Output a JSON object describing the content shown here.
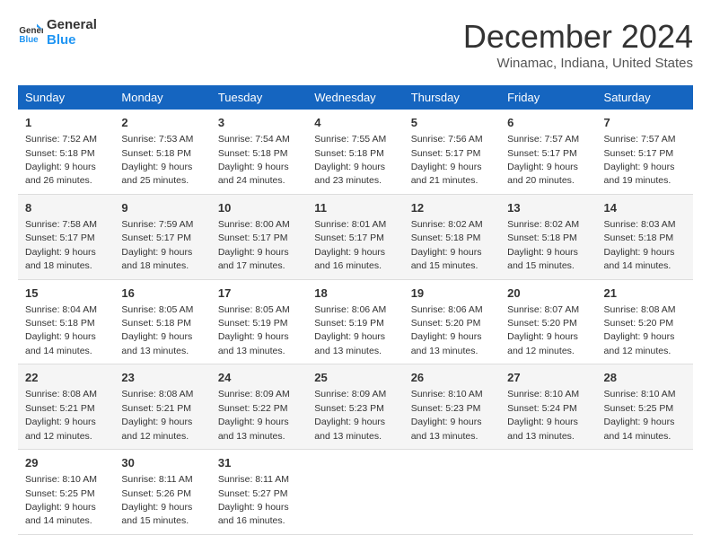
{
  "logo": {
    "line1": "General",
    "line2": "Blue"
  },
  "title": "December 2024",
  "location": "Winamac, Indiana, United States",
  "days_of_week": [
    "Sunday",
    "Monday",
    "Tuesday",
    "Wednesday",
    "Thursday",
    "Friday",
    "Saturday"
  ],
  "weeks": [
    [
      {
        "num": "1",
        "sunrise": "7:52 AM",
        "sunset": "5:18 PM",
        "daylight": "9 hours and 26 minutes."
      },
      {
        "num": "2",
        "sunrise": "7:53 AM",
        "sunset": "5:18 PM",
        "daylight": "9 hours and 25 minutes."
      },
      {
        "num": "3",
        "sunrise": "7:54 AM",
        "sunset": "5:18 PM",
        "daylight": "9 hours and 24 minutes."
      },
      {
        "num": "4",
        "sunrise": "7:55 AM",
        "sunset": "5:18 PM",
        "daylight": "9 hours and 23 minutes."
      },
      {
        "num": "5",
        "sunrise": "7:56 AM",
        "sunset": "5:17 PM",
        "daylight": "9 hours and 21 minutes."
      },
      {
        "num": "6",
        "sunrise": "7:57 AM",
        "sunset": "5:17 PM",
        "daylight": "9 hours and 20 minutes."
      },
      {
        "num": "7",
        "sunrise": "7:57 AM",
        "sunset": "5:17 PM",
        "daylight": "9 hours and 19 minutes."
      }
    ],
    [
      {
        "num": "8",
        "sunrise": "7:58 AM",
        "sunset": "5:17 PM",
        "daylight": "9 hours and 18 minutes."
      },
      {
        "num": "9",
        "sunrise": "7:59 AM",
        "sunset": "5:17 PM",
        "daylight": "9 hours and 18 minutes."
      },
      {
        "num": "10",
        "sunrise": "8:00 AM",
        "sunset": "5:17 PM",
        "daylight": "9 hours and 17 minutes."
      },
      {
        "num": "11",
        "sunrise": "8:01 AM",
        "sunset": "5:17 PM",
        "daylight": "9 hours and 16 minutes."
      },
      {
        "num": "12",
        "sunrise": "8:02 AM",
        "sunset": "5:18 PM",
        "daylight": "9 hours and 15 minutes."
      },
      {
        "num": "13",
        "sunrise": "8:02 AM",
        "sunset": "5:18 PM",
        "daylight": "9 hours and 15 minutes."
      },
      {
        "num": "14",
        "sunrise": "8:03 AM",
        "sunset": "5:18 PM",
        "daylight": "9 hours and 14 minutes."
      }
    ],
    [
      {
        "num": "15",
        "sunrise": "8:04 AM",
        "sunset": "5:18 PM",
        "daylight": "9 hours and 14 minutes."
      },
      {
        "num": "16",
        "sunrise": "8:05 AM",
        "sunset": "5:18 PM",
        "daylight": "9 hours and 13 minutes."
      },
      {
        "num": "17",
        "sunrise": "8:05 AM",
        "sunset": "5:19 PM",
        "daylight": "9 hours and 13 minutes."
      },
      {
        "num": "18",
        "sunrise": "8:06 AM",
        "sunset": "5:19 PM",
        "daylight": "9 hours and 13 minutes."
      },
      {
        "num": "19",
        "sunrise": "8:06 AM",
        "sunset": "5:20 PM",
        "daylight": "9 hours and 13 minutes."
      },
      {
        "num": "20",
        "sunrise": "8:07 AM",
        "sunset": "5:20 PM",
        "daylight": "9 hours and 12 minutes."
      },
      {
        "num": "21",
        "sunrise": "8:08 AM",
        "sunset": "5:20 PM",
        "daylight": "9 hours and 12 minutes."
      }
    ],
    [
      {
        "num": "22",
        "sunrise": "8:08 AM",
        "sunset": "5:21 PM",
        "daylight": "9 hours and 12 minutes."
      },
      {
        "num": "23",
        "sunrise": "8:08 AM",
        "sunset": "5:21 PM",
        "daylight": "9 hours and 12 minutes."
      },
      {
        "num": "24",
        "sunrise": "8:09 AM",
        "sunset": "5:22 PM",
        "daylight": "9 hours and 13 minutes."
      },
      {
        "num": "25",
        "sunrise": "8:09 AM",
        "sunset": "5:23 PM",
        "daylight": "9 hours and 13 minutes."
      },
      {
        "num": "26",
        "sunrise": "8:10 AM",
        "sunset": "5:23 PM",
        "daylight": "9 hours and 13 minutes."
      },
      {
        "num": "27",
        "sunrise": "8:10 AM",
        "sunset": "5:24 PM",
        "daylight": "9 hours and 13 minutes."
      },
      {
        "num": "28",
        "sunrise": "8:10 AM",
        "sunset": "5:25 PM",
        "daylight": "9 hours and 14 minutes."
      }
    ],
    [
      {
        "num": "29",
        "sunrise": "8:10 AM",
        "sunset": "5:25 PM",
        "daylight": "9 hours and 14 minutes."
      },
      {
        "num": "30",
        "sunrise": "8:11 AM",
        "sunset": "5:26 PM",
        "daylight": "9 hours and 15 minutes."
      },
      {
        "num": "31",
        "sunrise": "8:11 AM",
        "sunset": "5:27 PM",
        "daylight": "9 hours and 16 minutes."
      },
      null,
      null,
      null,
      null
    ]
  ]
}
